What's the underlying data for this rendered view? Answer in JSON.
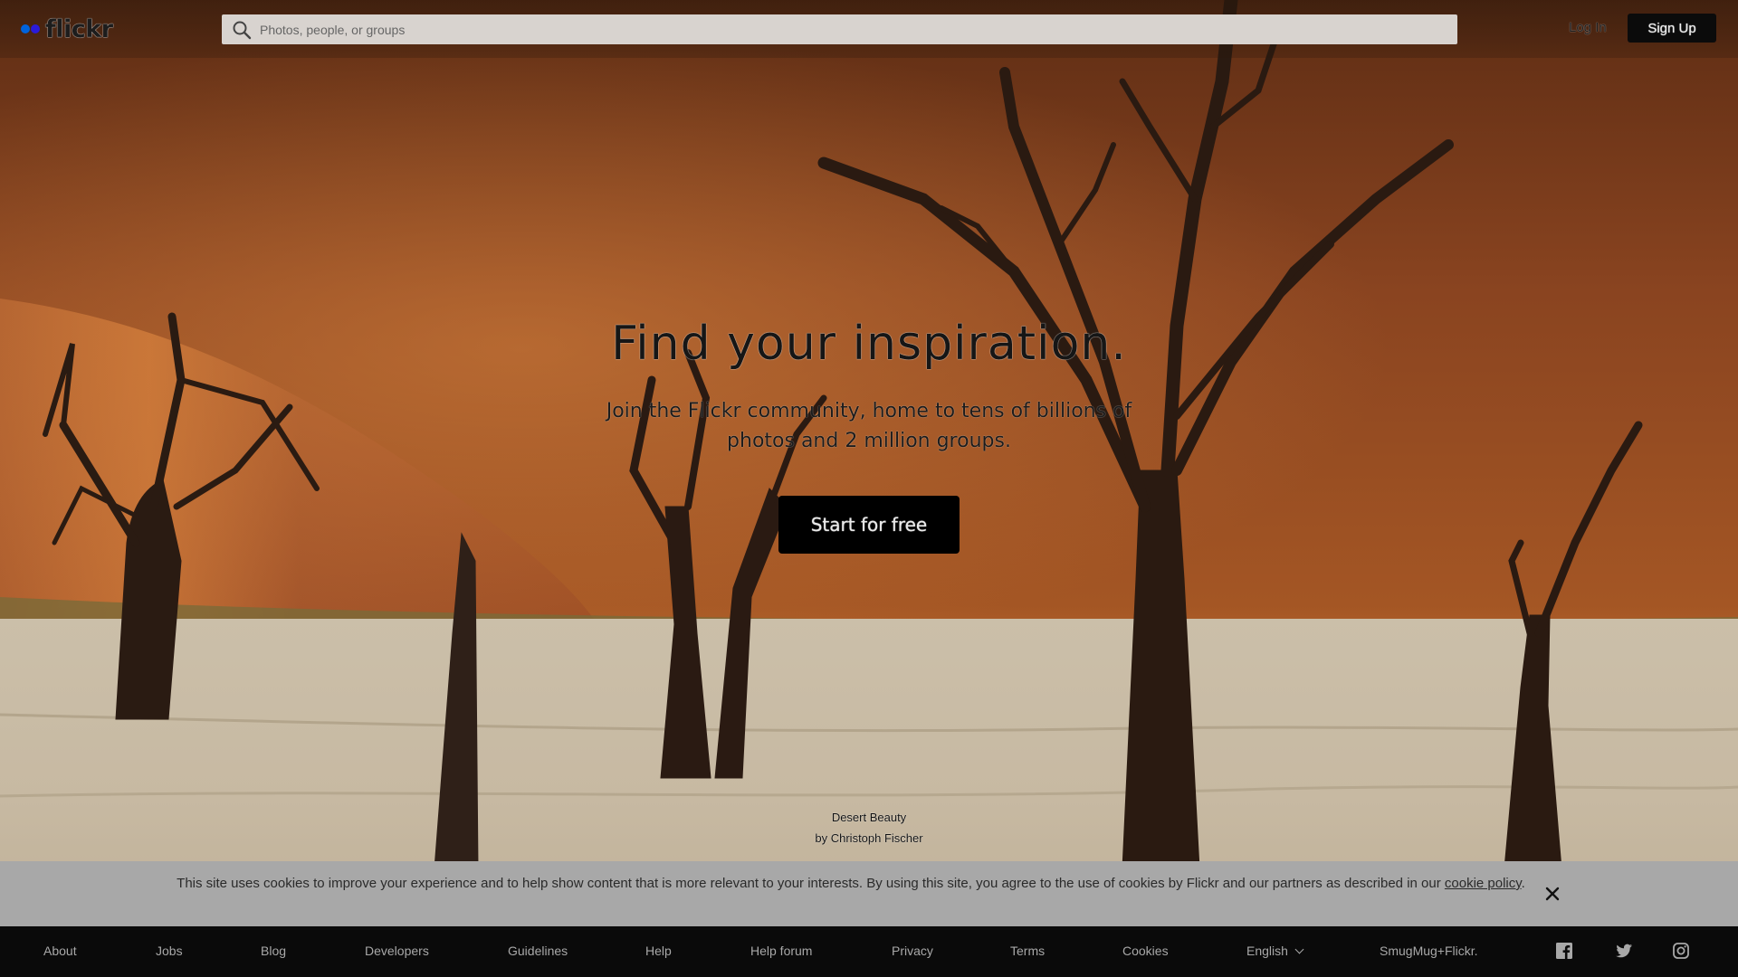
{
  "header": {
    "brand": "flickr",
    "search_placeholder": "Photos, people, or groups",
    "login_label": "Log In",
    "signup_label": "Sign Up"
  },
  "hero": {
    "title": "Find your inspiration.",
    "subtitle": "Join the Flickr community, home to tens of billions of photos and 2 million groups.",
    "cta_label": "Start for free"
  },
  "photo_credit": {
    "title": "Desert Beauty",
    "author_line": "by Christoph Fischer"
  },
  "cookie_banner": {
    "message": "This site uses cookies to improve your experience and to help show content that is more relevant to your interests. By using this site, you agree to the use of cookies by Flickr and our partners as described in our",
    "policy_link": "cookie policy",
    "trailing": "."
  },
  "footer": {
    "links": [
      "About",
      "Jobs",
      "Blog",
      "Developers",
      "Guidelines",
      "Help",
      "Help forum",
      "Privacy",
      "Terms",
      "Cookies"
    ],
    "language": "English",
    "smugmug": "SmugMug+Flickr."
  },
  "icons": {
    "search": "search-icon",
    "close": "close-icon",
    "facebook": "facebook-icon",
    "twitter": "twitter-icon",
    "instagram": "instagram-icon"
  },
  "colors": {
    "flickr_blue": "#0063dc",
    "flickr_dot_2": "#2a1bd8",
    "cookie_banner_bg": "#a8a8a8",
    "footer_bg": "#0a0a0a",
    "cta_bg": "#000000"
  }
}
